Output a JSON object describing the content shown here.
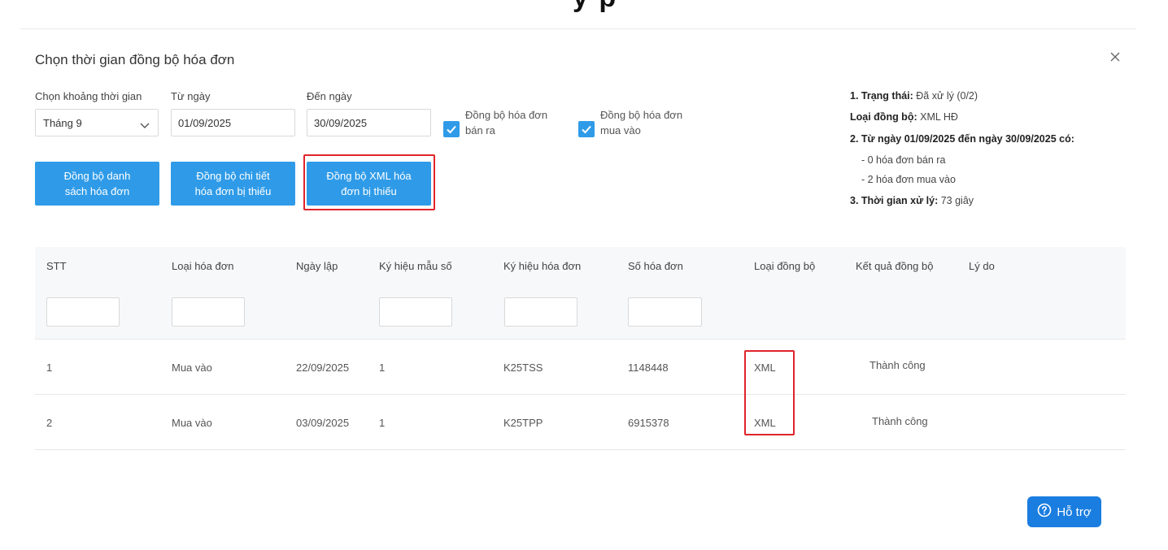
{
  "top_fragment": "y p",
  "modal": {
    "title": "Chọn thời gian đồng bộ hóa đơn"
  },
  "filters": {
    "period_label": "Chọn khoảng thời gian",
    "period_value": "Tháng 9",
    "from_label": "Từ ngày",
    "from_value": "01/09/2025",
    "to_label": "Đến ngày",
    "to_value": "30/09/2025",
    "sync_sell_line1": "Đồng bộ hóa đơn",
    "sync_sell_line2": "bán ra",
    "sync_sell_checked": true,
    "sync_buy_line1": "Đồng bộ hóa đơn",
    "sync_buy_line2": "mua vào",
    "sync_buy_checked": true
  },
  "buttons": {
    "sync_list_line1": "Đồng bộ danh",
    "sync_list_line2": "sách hóa đơn",
    "sync_detail_line1": "Đồng bộ chi tiết",
    "sync_detail_line2": "hóa đơn bị thiếu",
    "sync_xml_line1": "Đồng bộ XML hóa",
    "sync_xml_line2": "đơn bị thiếu"
  },
  "info": {
    "status_label": "1. Trạng thái:",
    "status_value": "Đã xử lý (0/2)",
    "sync_type_label": "Loại đồng bộ:",
    "sync_type_value": "XML HĐ",
    "range_text": "2. Từ ngày 01/09/2025 đến ngày 30/09/2025 có:",
    "sell_count": "- 0 hóa đơn bán ra",
    "buy_count": "- 2 hóa đơn mua vào",
    "time_label": "3. Thời gian xử lý:",
    "time_value": "73 giây"
  },
  "table": {
    "headers": [
      "STT",
      "Loại hóa đơn",
      "Ngày lập",
      "Ký hiệu mẫu số",
      "Ký hiệu hóa đơn",
      "Số hóa đơn",
      "Loại đồng bộ",
      "Kết quả đồng bộ",
      "Lý do"
    ],
    "rows": [
      [
        "1",
        "Mua vào",
        "22/09/2025",
        "1",
        "K25TSS",
        "1148448",
        "XML",
        "Thành công",
        ""
      ],
      [
        "2",
        "Mua vào",
        "03/09/2025",
        "1",
        "K25TPP",
        "6915378",
        "XML",
        "Thành công",
        ""
      ]
    ]
  },
  "help": {
    "label": "Hỗ trợ"
  },
  "colors": {
    "primary": "#2f9be8",
    "highlight": "#e0242b",
    "help_button": "#1a7de0"
  }
}
